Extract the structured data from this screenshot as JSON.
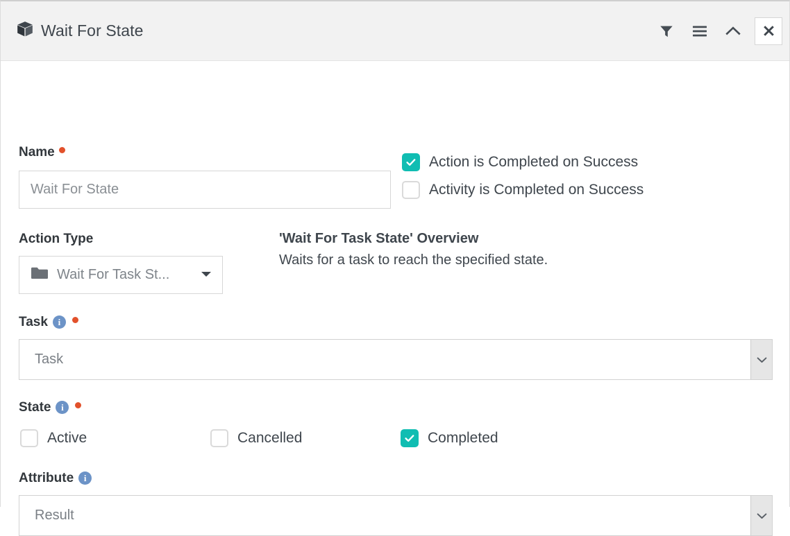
{
  "window": {
    "title": "Wait For State",
    "title_icon": "box-icon",
    "actions": [
      {
        "name": "filter-icon",
        "label": "Filter"
      },
      {
        "name": "menu-icon",
        "label": "Menu"
      },
      {
        "name": "collapse-icon",
        "label": "Collapse"
      },
      {
        "name": "close-icon",
        "label": "Close"
      }
    ]
  },
  "form": {
    "name": {
      "label": "Name",
      "required": true,
      "value": "",
      "placeholder": "Wait For State"
    },
    "success_options": [
      {
        "label": "Action is Completed on Success",
        "checked": true
      },
      {
        "label": "Activity is Completed on Success",
        "checked": false
      }
    ],
    "action_type": {
      "label": "Action Type",
      "icon": "folder-icon",
      "value": "Wait For Task St...",
      "arrow": "caret-down-icon"
    },
    "overview": {
      "title": "'Wait For Task State' Overview",
      "description": "Waits for a task to reach the specified state."
    },
    "task": {
      "label": "Task",
      "required": true,
      "info": "i",
      "value": "Task",
      "arrow": "chevron-down-icon"
    },
    "state": {
      "label": "State",
      "required": true,
      "info": "i",
      "options": [
        {
          "label": "Active",
          "checked": false
        },
        {
          "label": "Cancelled",
          "checked": false
        },
        {
          "label": "Completed",
          "checked": true
        }
      ]
    },
    "attribute": {
      "label": "Attribute",
      "required": false,
      "info": "i",
      "value": "Result",
      "arrow": "chevron-down-icon"
    }
  },
  "colors": {
    "accent_teal": "#10bdb2",
    "required_red": "#e2512b",
    "info_blue": "#6c93c7",
    "header_bg": "#f2f2f2"
  }
}
